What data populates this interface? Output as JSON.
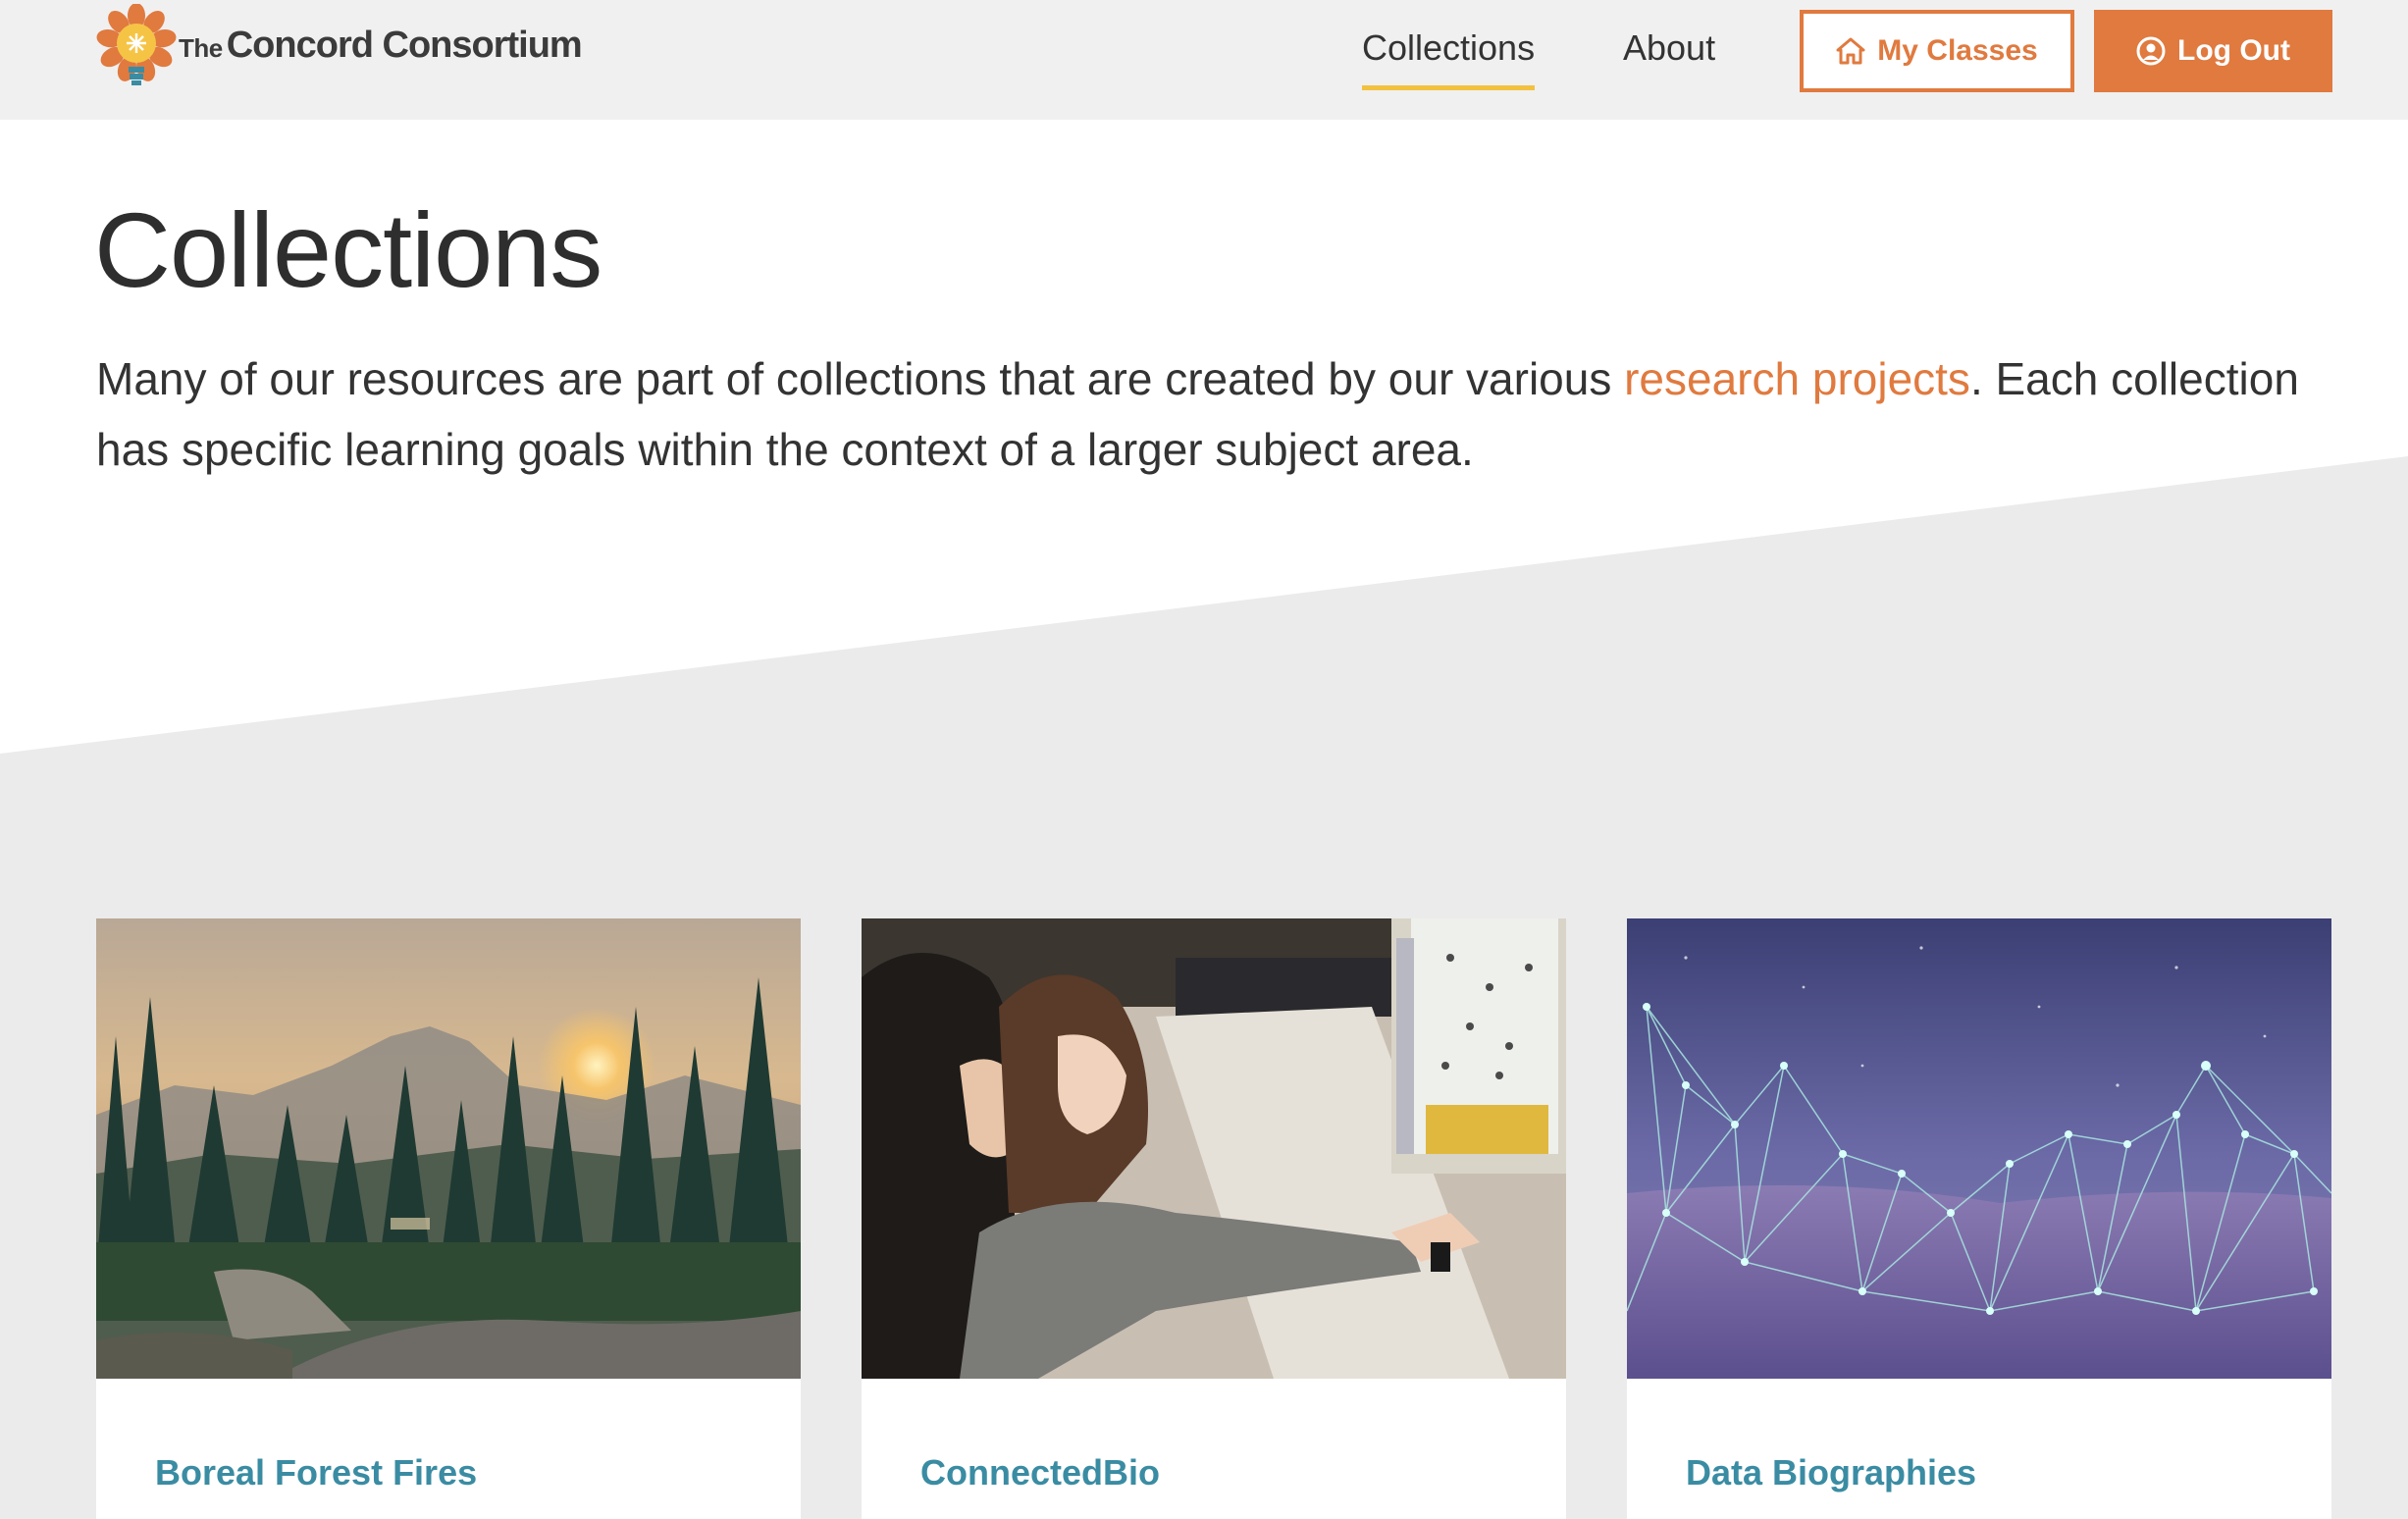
{
  "header": {
    "logo": {
      "the": "The",
      "name": "Concord Consortium"
    },
    "nav": [
      {
        "label": "Collections",
        "active": true
      },
      {
        "label": "About",
        "active": false
      }
    ],
    "my_classes_label": "My Classes",
    "log_out_label": "Log Out"
  },
  "main": {
    "title": "Collections",
    "intro_before": "Many of our resources are part of collections that are created by our various ",
    "intro_link": "research projects",
    "intro_after": ". Each collection has specific learning goals within the context of a larger subject area."
  },
  "cards": [
    {
      "title": "Boreal Forest Fires",
      "image": "forest-sunset-photo"
    },
    {
      "title": "ConnectedBio",
      "image": "students-at-computer-photo"
    },
    {
      "title": "Data Biographies",
      "image": "network-desert-photo"
    }
  ],
  "colors": {
    "accent": "#e07a3f",
    "nav_underline": "#f2c13f",
    "card_title": "#3a8ca3",
    "header_bg": "#f0f0f0",
    "section_bg": "#ebebeb"
  }
}
